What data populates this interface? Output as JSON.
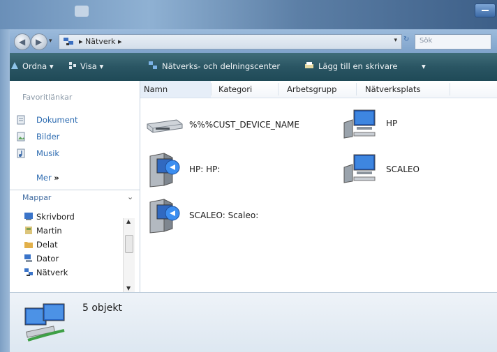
{
  "window": {
    "accent_title": "#5c7fa6",
    "toolbar_color": "#2a5563"
  },
  "address_bar": {
    "crumbs": [
      "Nätverk"
    ],
    "search_placeholder": "Sök",
    "location_icon": "network-icon"
  },
  "toolbar": {
    "items": [
      {
        "label": "Ordna",
        "icon": "organize-icon"
      },
      {
        "label": "Visa",
        "icon": "views-icon"
      },
      {
        "label": "Nätverks- och delningscenter",
        "icon": "network-sharing-icon"
      },
      {
        "label": "Lägg till en skrivare",
        "icon": "add-printer-icon"
      }
    ]
  },
  "sidebar": {
    "favorites_title": "Favoritlänkar",
    "favorites": [
      {
        "label": "Dokument",
        "icon": "documents-icon"
      },
      {
        "label": "Bilder",
        "icon": "pictures-icon"
      },
      {
        "label": "Musik",
        "icon": "music-icon"
      }
    ],
    "more_label": "Mer",
    "more_chevrons": "»",
    "folders_title": "Mappar",
    "folders": [
      {
        "label": "Skrivbord",
        "icon": "desktop-icon"
      },
      {
        "label": "Martin",
        "icon": "user-folder-icon"
      },
      {
        "label": "Delat",
        "icon": "shared-folder-icon"
      },
      {
        "label": "Dator",
        "icon": "computer-icon"
      },
      {
        "label": "Nätverk",
        "icon": "network-icon",
        "selected": true
      }
    ]
  },
  "columns": [
    "Namn",
    "Kategori",
    "Arbetsgrupp",
    "Nätverksplats"
  ],
  "items": [
    {
      "label": "%%%CUST_DEVICE_NAME",
      "icon": "network-device-icon"
    },
    {
      "label": "HP",
      "icon": "computer-icon"
    },
    {
      "label": "HP: HP:",
      "icon": "media-server-icon"
    },
    {
      "label": "SCALEO",
      "icon": "computer-icon"
    },
    {
      "label": "SCALEO: Scaleo:",
      "icon": "media-server-icon"
    }
  ],
  "status": {
    "count_text": "5 objekt",
    "icon": "network-computers-icon"
  }
}
